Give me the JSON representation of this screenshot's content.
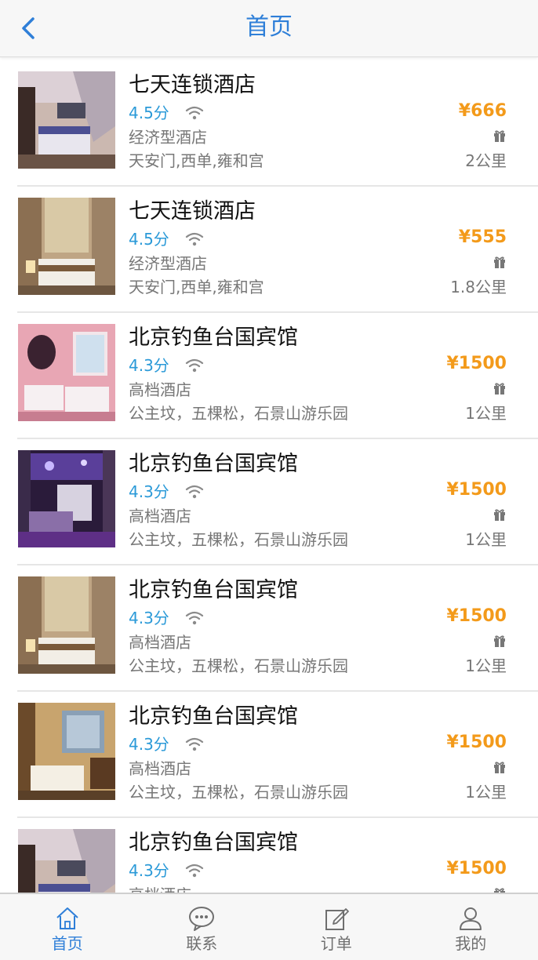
{
  "nav": {
    "title": "首页",
    "back_icon": "chevron-left-icon"
  },
  "colors": {
    "accent": "#2f7fd8",
    "rating": "#2b9ad8",
    "price": "#f39a1a",
    "muted": "#777777"
  },
  "hotels": [
    {
      "name": "七天连锁酒店",
      "rating": "4.5分",
      "type": "经济型酒店",
      "area": "天安门,西单,雍和宫",
      "price": "¥666",
      "distance": "2公里"
    },
    {
      "name": "七天连锁酒店",
      "rating": "4.5分",
      "type": "经济型酒店",
      "area": "天安门,西单,雍和宫",
      "price": "¥555",
      "distance": "1.8公里"
    },
    {
      "name": "北京钓鱼台国宾馆",
      "rating": "4.3分",
      "type": "高档酒店",
      "area": "公主坟，五棵松，石景山游乐园",
      "price": "¥1500",
      "distance": "1公里"
    },
    {
      "name": "北京钓鱼台国宾馆",
      "rating": "4.3分",
      "type": "高档酒店",
      "area": "公主坟，五棵松，石景山游乐园",
      "price": "¥1500",
      "distance": "1公里"
    },
    {
      "name": "北京钓鱼台国宾馆",
      "rating": "4.3分",
      "type": "高档酒店",
      "area": "公主坟，五棵松，石景山游乐园",
      "price": "¥1500",
      "distance": "1公里"
    },
    {
      "name": "北京钓鱼台国宾馆",
      "rating": "4.3分",
      "type": "高档酒店",
      "area": "公主坟，五棵松，石景山游乐园",
      "price": "¥1500",
      "distance": "1公里"
    },
    {
      "name": "北京钓鱼台国宾馆",
      "rating": "4.3分",
      "type": "高档酒店",
      "area": "",
      "price": "¥1500",
      "distance": ""
    }
  ],
  "tabs": [
    {
      "label": "首页",
      "icon": "home-icon",
      "active": true
    },
    {
      "label": "联系",
      "icon": "chat-bubble-icon",
      "active": false
    },
    {
      "label": "订单",
      "icon": "edit-order-icon",
      "active": false
    },
    {
      "label": "我的",
      "icon": "user-icon",
      "active": false
    }
  ]
}
